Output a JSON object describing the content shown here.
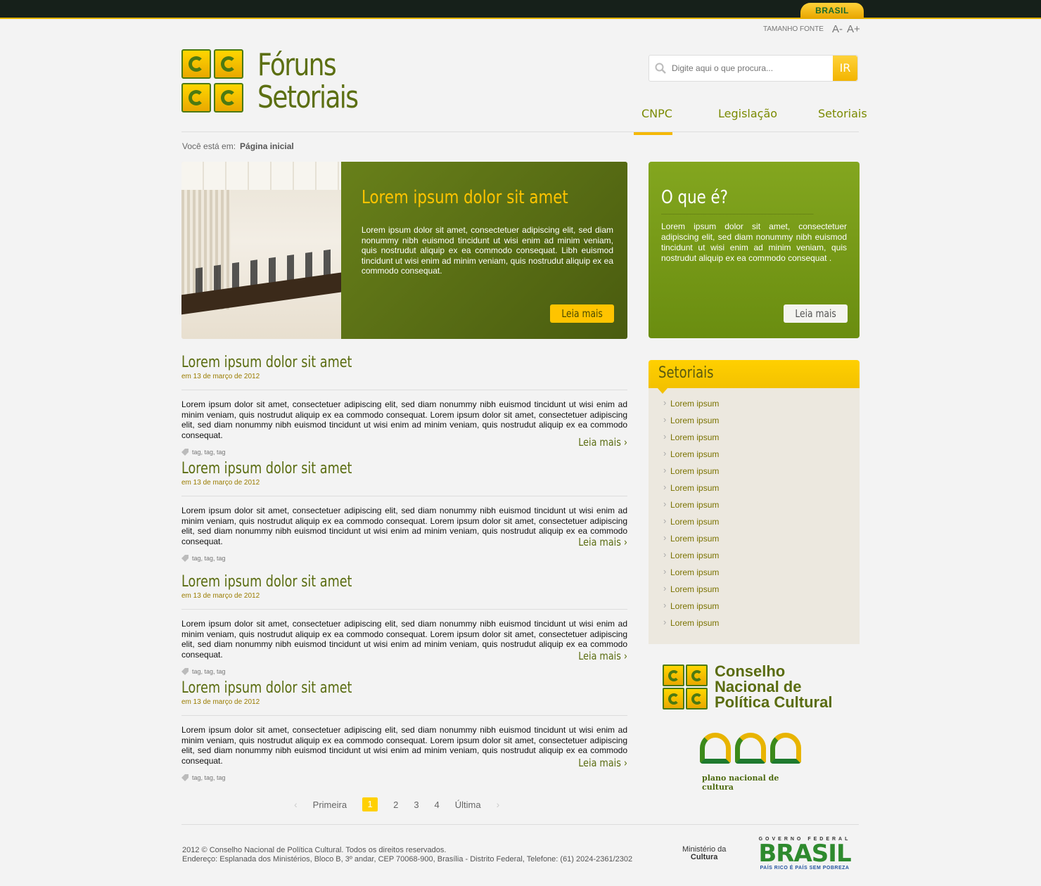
{
  "topbar": {
    "brasil_label": "BRASIL"
  },
  "font_size": {
    "label": "TAMANHO FONTE",
    "decrease": "A-",
    "increase": "A+"
  },
  "logo": {
    "line1": "Fóruns",
    "line2": "Setoriais"
  },
  "search": {
    "placeholder": "Digite aqui o que procura...",
    "button": "IR"
  },
  "nav": {
    "items": [
      "CNPC",
      "Legislação",
      "Setoriais"
    ],
    "active": "CNPC"
  },
  "breadcrumb": {
    "prefix": "Você está em:",
    "current": "Página inicial"
  },
  "feature": {
    "title": "Lorem ipsum dolor sit amet",
    "text": "Lorem ipsum dolor sit amet, consectetuer adipiscing elit, sed diam nonummy nibh euismod tincidunt ut wisi enim ad minim veniam, quis nostrudut aliquip ex ea commodo consequat. Libh euismod tincidunt ut wisi enim ad minim veniam, quis nostrudut aliquip ex ea commodo consequat.",
    "button": "Leia mais"
  },
  "oque": {
    "title": "O que é?",
    "text": "Lorem ipsum dolor sit amet, consectetuer adipiscing elit, sed diam nonummy nibh euismod tincidunt ut wisi enim ad minim veniam, quis nostrudut aliquip ex ea commodo consequat .",
    "button": "Leia mais"
  },
  "posts": [
    {
      "title": "Lorem ipsum dolor sit amet",
      "date": "em 13 de março de 2012",
      "text": "Lorem ipsum dolor sit amet, consectetuer adipiscing elit, sed diam nonummy nibh euismod tincidunt ut wisi enim ad minim veniam, quis nostrudut aliquip ex ea commodo consequat. Lorem ipsum dolor sit amet, consectetuer adipiscing elit, sed diam nonummy nibh euismod tincidunt ut wisi enim ad minim veniam, quis nostrudut aliquip ex ea commodo consequat.",
      "tags": "tag, tag, tag",
      "more": "Leia mais ›"
    },
    {
      "title": "Lorem ipsum dolor sit amet",
      "date": "em 13 de março de 2012",
      "text": "Lorem ipsum dolor sit amet, consectetuer adipiscing elit, sed diam nonummy nibh euismod tincidunt ut wisi enim ad minim veniam, quis nostrudut aliquip ex ea commodo consequat. Lorem ipsum dolor sit amet, consectetuer adipiscing elit, sed diam nonummy nibh euismod tincidunt ut wisi enim ad minim veniam, quis nostrudut aliquip ex ea commodo consequat.",
      "tags": "tag, tag, tag",
      "more": "Leia mais ›"
    },
    {
      "title": "Lorem ipsum dolor sit amet",
      "date": "em 13 de março de 2012",
      "text": "Lorem ipsum dolor sit amet, consectetuer adipiscing elit, sed diam nonummy nibh euismod tincidunt ut wisi enim ad minim veniam, quis nostrudut aliquip ex ea commodo consequat. Lorem ipsum dolor sit amet, consectetuer adipiscing elit, sed diam nonummy nibh euismod tincidunt ut wisi enim ad minim veniam, quis nostrudut aliquip ex ea commodo consequat.",
      "tags": "tag, tag, tag",
      "more": "Leia mais ›"
    },
    {
      "title": "Lorem ipsum dolor sit amet",
      "date": "em 13 de março de 2012",
      "text": "Lorem ipsum dolor sit amet, consectetuer adipiscing elit, sed diam nonummy nibh euismod tincidunt ut wisi enim ad minim veniam, quis nostrudut aliquip ex ea commodo consequat. Lorem ipsum dolor sit amet, consectetuer adipiscing elit, sed diam nonummy nibh euismod tincidunt ut wisi enim ad minim veniam, quis nostrudut aliquip ex ea commodo consequat.",
      "tags": "tag, tag, tag",
      "more": "Leia mais ›"
    }
  ],
  "pager": {
    "first": "Primeira",
    "pages": [
      "1",
      "2",
      "3",
      "4"
    ],
    "last": "Última",
    "current": "1"
  },
  "setoriais": {
    "title": "Setoriais",
    "items": [
      "Lorem ipsum",
      "Lorem ipsum",
      "Lorem ipsum",
      "Lorem ipsum",
      "Lorem ipsum",
      "Lorem ipsum",
      "Lorem ipsum",
      "Lorem ipsum",
      "Lorem ipsum",
      "Lorem ipsum",
      "Lorem ipsum",
      "Lorem ipsum",
      "Lorem ipsum",
      "Lorem ipsum"
    ]
  },
  "cnpc_logo": {
    "line1": "Conselho",
    "line2": "Nacional de",
    "line3": "Política Cultural"
  },
  "pnc_logo": {
    "label": "plano nacional de cultura"
  },
  "footer": {
    "line1": "2012 © Conselho Nacional de Política Cultural. Todos os direitos reservados.",
    "line2": "Endereço: Esplanada dos Ministérios, Bloco B, 3º andar, CEP 70068-900, Brasília - Distrito Federal, Telefone: (61) 2024-2361/2302",
    "minc_line1": "Ministério da",
    "minc_line2": "Cultura",
    "gov_top": "GOVERNO FEDERAL",
    "gov_mid": "BRASIL",
    "gov_bot": "PAÍS RICO É PAÍS SEM POBREZA"
  }
}
